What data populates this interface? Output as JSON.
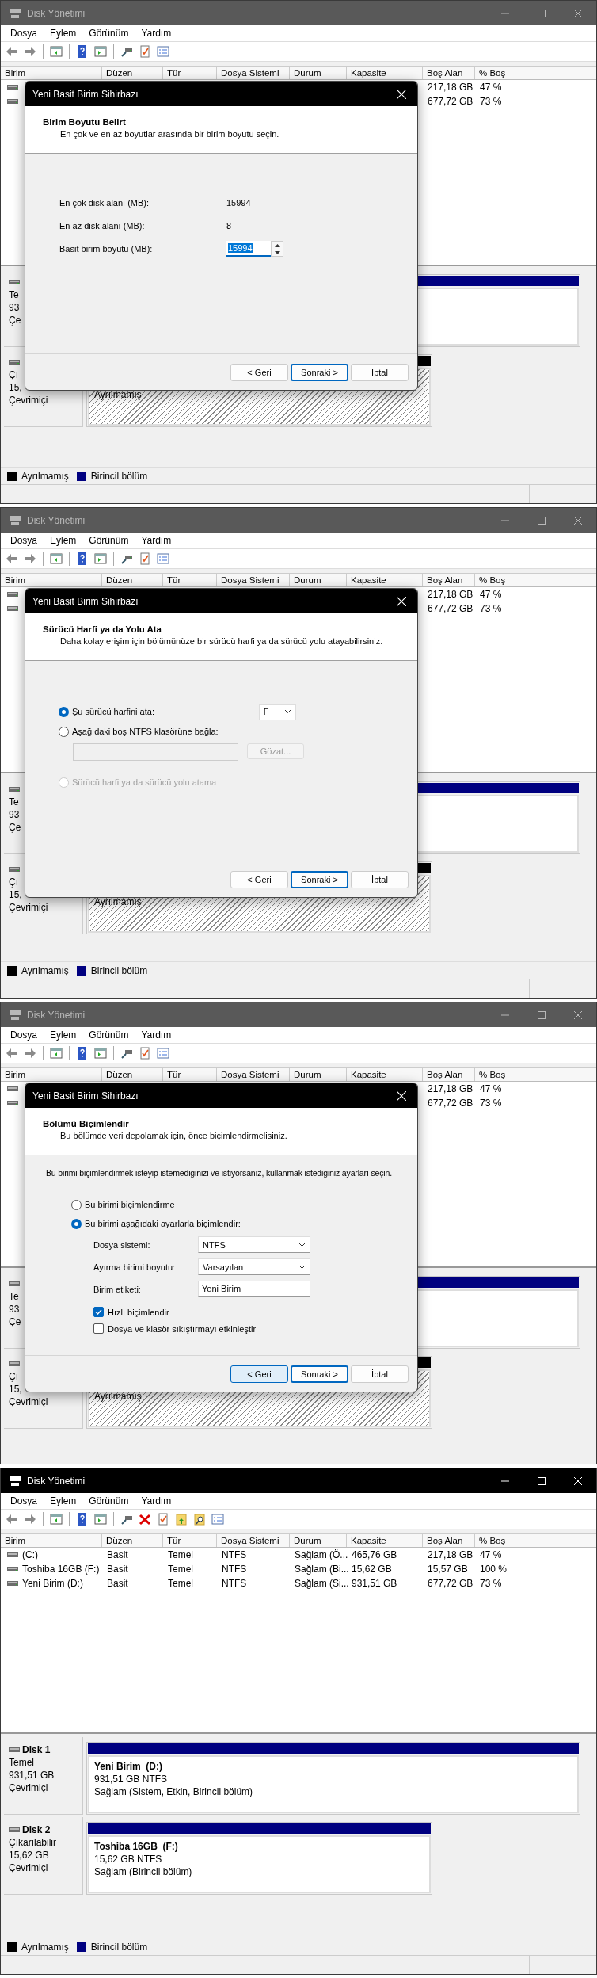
{
  "panels": [
    {
      "window": {
        "title": "Disk Yönetimi",
        "active": false
      },
      "menu": [
        "Dosya",
        "Eylem",
        "Görünüm",
        "Yardım"
      ],
      "toolbar": [
        {
          "kind": "back"
        },
        {
          "kind": "forward"
        },
        {
          "kind": "separator"
        },
        {
          "kind": "console"
        },
        {
          "kind": "separator"
        },
        {
          "kind": "help"
        },
        {
          "kind": "pane"
        },
        {
          "kind": "separator"
        },
        {
          "kind": "connect"
        },
        {
          "kind": "check"
        },
        {
          "kind": "list"
        }
      ],
      "columns": [
        "Birim",
        "Düzen",
        "Tür",
        "Dosya Sistemi",
        "Durum",
        "Kapasite",
        "Boş Alan",
        "% Boş"
      ],
      "rows": [
        {
          "free": "217,18 GB",
          "percent": "47 %"
        },
        {
          "free": "677,72 GB",
          "percent": "73 %"
        }
      ],
      "disks": [
        {
          "lines": [
            "Te",
            "93",
            "Çe"
          ],
          "partitions": [
            {
              "kind": "primary"
            }
          ]
        },
        {
          "lines": [
            "Çı",
            "15,",
            "Çevrimiçi"
          ],
          "partitions": [
            {
              "kind": "unallocated",
              "lines": [
                "Ayrılmamış"
              ]
            }
          ]
        }
      ],
      "legend": [
        {
          "label": "Ayrılmamış",
          "color": "#000000"
        },
        {
          "label": "Birincil bölüm",
          "color": "#000080"
        }
      ],
      "dialog": {
        "kind": "size",
        "title": "Yeni Basit Birim Sihirbazı",
        "heading": "Birim Boyutu Belirt",
        "subheading": "En çok ve en az boyutlar arasında bir birim boyutu seçin.",
        "fields": [
          {
            "label": "En çok disk alanı (MB):",
            "value": "15994",
            "kind": "text"
          },
          {
            "label": "En az disk alanı (MB):",
            "value": "8",
            "kind": "text"
          },
          {
            "label": "Basit birim boyutu (MB):",
            "value": "15994",
            "kind": "spinner",
            "highlighted": true
          }
        ],
        "buttons": [
          {
            "label": "< Geri",
            "kind": "normal"
          },
          {
            "label": "Sonraki >",
            "kind": "default"
          },
          {
            "label": "İptal",
            "kind": "normal"
          }
        ]
      }
    },
    {
      "window": {
        "title": "Disk Yönetimi",
        "active": false
      },
      "menu": [
        "Dosya",
        "Eylem",
        "Görünüm",
        "Yardım"
      ],
      "toolbar": [
        {
          "kind": "back"
        },
        {
          "kind": "forward"
        },
        {
          "kind": "separator"
        },
        {
          "kind": "console"
        },
        {
          "kind": "separator"
        },
        {
          "kind": "help"
        },
        {
          "kind": "pane"
        },
        {
          "kind": "separator"
        },
        {
          "kind": "connect"
        },
        {
          "kind": "check"
        },
        {
          "kind": "list"
        }
      ],
      "columns": [
        "Birim",
        "Düzen",
        "Tür",
        "Dosya Sistemi",
        "Durum",
        "Kapasite",
        "Boş Alan",
        "% Boş"
      ],
      "rows": [
        {
          "free": "217,18 GB",
          "percent": "47 %"
        },
        {
          "free": "677,72 GB",
          "percent": "73 %"
        }
      ],
      "disks": [
        {
          "lines": [
            "Te",
            "93",
            "Çe"
          ],
          "partitions": [
            {
              "kind": "primary"
            }
          ]
        },
        {
          "lines": [
            "Çı",
            "15,",
            "Çevrimiçi"
          ],
          "partitions": [
            {
              "kind": "unallocated",
              "lines": [
                "Ayrılmamış"
              ]
            }
          ]
        }
      ],
      "legend": [
        {
          "label": "Ayrılmamış",
          "color": "#000000"
        },
        {
          "label": "Birincil bölüm",
          "color": "#000080"
        }
      ],
      "dialog": {
        "kind": "letter",
        "title": "Yeni Basit Birim Sihirbazı",
        "heading": "Sürücü Harfi ya da Yolu Ata",
        "subheading": "Daha kolay erişim için bölümünüze bir sürücü harfi ya da sürücü yolu atayabilirsiniz.",
        "options": [
          {
            "label": "Şu sürücü harfini ata:",
            "selected": true,
            "disabled": false,
            "letter": "F"
          },
          {
            "label": "Aşağıdaki boş NTFS klasörüne bağla:",
            "selected": false,
            "disabled": false,
            "browse": {
              "label": "Gözat...",
              "disabled": true
            }
          },
          {
            "label": "Sürücü harfi ya da sürücü yolu atama",
            "selected": false,
            "disabled": true
          }
        ],
        "buttons": [
          {
            "label": "< Geri",
            "kind": "normal"
          },
          {
            "label": "Sonraki >",
            "kind": "default"
          },
          {
            "label": "İptal",
            "kind": "normal"
          }
        ]
      }
    },
    {
      "window": {
        "title": "Disk Yönetimi",
        "active": false
      },
      "menu": [
        "Dosya",
        "Eylem",
        "Görünüm",
        "Yardım"
      ],
      "toolbar": [
        {
          "kind": "back"
        },
        {
          "kind": "forward"
        },
        {
          "kind": "separator"
        },
        {
          "kind": "console"
        },
        {
          "kind": "separator"
        },
        {
          "kind": "help"
        },
        {
          "kind": "pane"
        },
        {
          "kind": "separator"
        },
        {
          "kind": "connect"
        },
        {
          "kind": "check"
        },
        {
          "kind": "list"
        }
      ],
      "columns": [
        "Birim",
        "Düzen",
        "Tür",
        "Dosya Sistemi",
        "Durum",
        "Kapasite",
        "Boş Alan",
        "% Boş"
      ],
      "rows": [
        {
          "free": "217,18 GB",
          "percent": "47 %"
        },
        {
          "free": "677,72 GB",
          "percent": "73 %"
        }
      ],
      "disks": [
        {
          "lines": [
            "Te",
            "93",
            "Çe"
          ],
          "partitions": [
            {
              "kind": "primary"
            }
          ]
        },
        {
          "lines": [
            "Çı",
            "15,",
            "Çevrimiçi"
          ],
          "partitions": [
            {
              "kind": "unallocated",
              "lines": [
                "Ayrılmamış"
              ]
            }
          ]
        }
      ],
      "dialog": {
        "kind": "format",
        "title": "Yeni Basit Birim Sihirbazı",
        "heading": "Bölümü Biçimlendir",
        "subheading": "Bu bölümde veri depolamak için, önce biçimlendirmelisiniz.",
        "intro": "Bu birimi biçimlendirmek isteyip istemediğinizi ve istiyorsanız, kullanmak istediğiniz ayarları seçin.",
        "options": [
          {
            "label": "Bu birimi biçimlendirme",
            "selected": false
          },
          {
            "label": "Bu birimi aşağıdaki ayarlarla biçimlendir:",
            "selected": true
          }
        ],
        "fields": [
          {
            "label": "Dosya sistemi:",
            "value": "NTFS",
            "kind": "select"
          },
          {
            "label": "Ayırma birimi boyutu:",
            "value": "Varsayılan",
            "kind": "select"
          },
          {
            "label": "Birim etiketi:",
            "value": "Yeni Birim",
            "kind": "text"
          }
        ],
        "checks": [
          {
            "label": "Hızlı biçimlendir",
            "checked": true
          },
          {
            "label": "Dosya ve klasör sıkıştırmayı etkinleştir",
            "checked": false
          }
        ],
        "buttons": [
          {
            "label": "< Geri",
            "kind": "hover"
          },
          {
            "label": "Sonraki >",
            "kind": "default"
          },
          {
            "label": "İptal",
            "kind": "normal"
          }
        ]
      }
    },
    {
      "window": {
        "title": "Disk Yönetimi",
        "active": true
      },
      "menu": [
        "Dosya",
        "Eylem",
        "Görünüm",
        "Yardım"
      ],
      "toolbar": [
        {
          "kind": "back"
        },
        {
          "kind": "forward"
        },
        {
          "kind": "separator"
        },
        {
          "kind": "console"
        },
        {
          "kind": "separator"
        },
        {
          "kind": "help"
        },
        {
          "kind": "pane"
        },
        {
          "kind": "separator"
        },
        {
          "kind": "connect"
        },
        {
          "kind": "delete"
        },
        {
          "kind": "check"
        },
        {
          "kind": "folder-up"
        },
        {
          "kind": "folder-search"
        },
        {
          "kind": "list"
        }
      ],
      "columns": [
        "Birim",
        "Düzen",
        "Tür",
        "Dosya Sistemi",
        "Durum",
        "Kapasite",
        "Boş Alan",
        "% Boş"
      ],
      "rows": [
        {
          "volume": "(C:)",
          "layout": "Basit",
          "type": "Temel",
          "filesystem": "NTFS",
          "status": "Sağlam (Ö...",
          "capacity": "465,76 GB",
          "free": "217,18 GB",
          "percent": "47 %"
        },
        {
          "volume": "Toshiba 16GB (F:)",
          "layout": "Basit",
          "type": "Temel",
          "filesystem": "NTFS",
          "status": "Sağlam (Bi...",
          "capacity": "15,62 GB",
          "free": "15,57 GB",
          "percent": "100 %"
        },
        {
          "volume": "Yeni Birim (D:)",
          "layout": "Basit",
          "type": "Temel",
          "filesystem": "NTFS",
          "status": "Sağlam (Si...",
          "capacity": "931,51 GB",
          "free": "677,72 GB",
          "percent": "73 %"
        }
      ],
      "disks": [
        {
          "name": "Disk 1",
          "lines": [
            "Temel",
            "931,51 GB",
            "Çevrimiçi"
          ],
          "partitions": [
            {
              "kind": "primary",
              "name": "Yeni Birim  (D:)",
              "lines": [
                "931,51 GB NTFS",
                "Sağlam (Sistem, Etkin, Birincil bölüm)"
              ]
            }
          ]
        },
        {
          "name": "Disk 2",
          "lines": [
            "Çıkarılabilir",
            "15,62 GB",
            "Çevrimiçi"
          ],
          "partitions": [
            {
              "kind": "primary",
              "name": "Toshiba 16GB  (F:)",
              "lines": [
                "15,62 GB NTFS",
                "Sağlam (Birincil bölüm)"
              ]
            }
          ]
        }
      ],
      "legend": [
        {
          "label": "Ayrılmamış",
          "color": "#000000"
        },
        {
          "label": "Birincil bölüm",
          "color": "#000080"
        }
      ]
    }
  ]
}
